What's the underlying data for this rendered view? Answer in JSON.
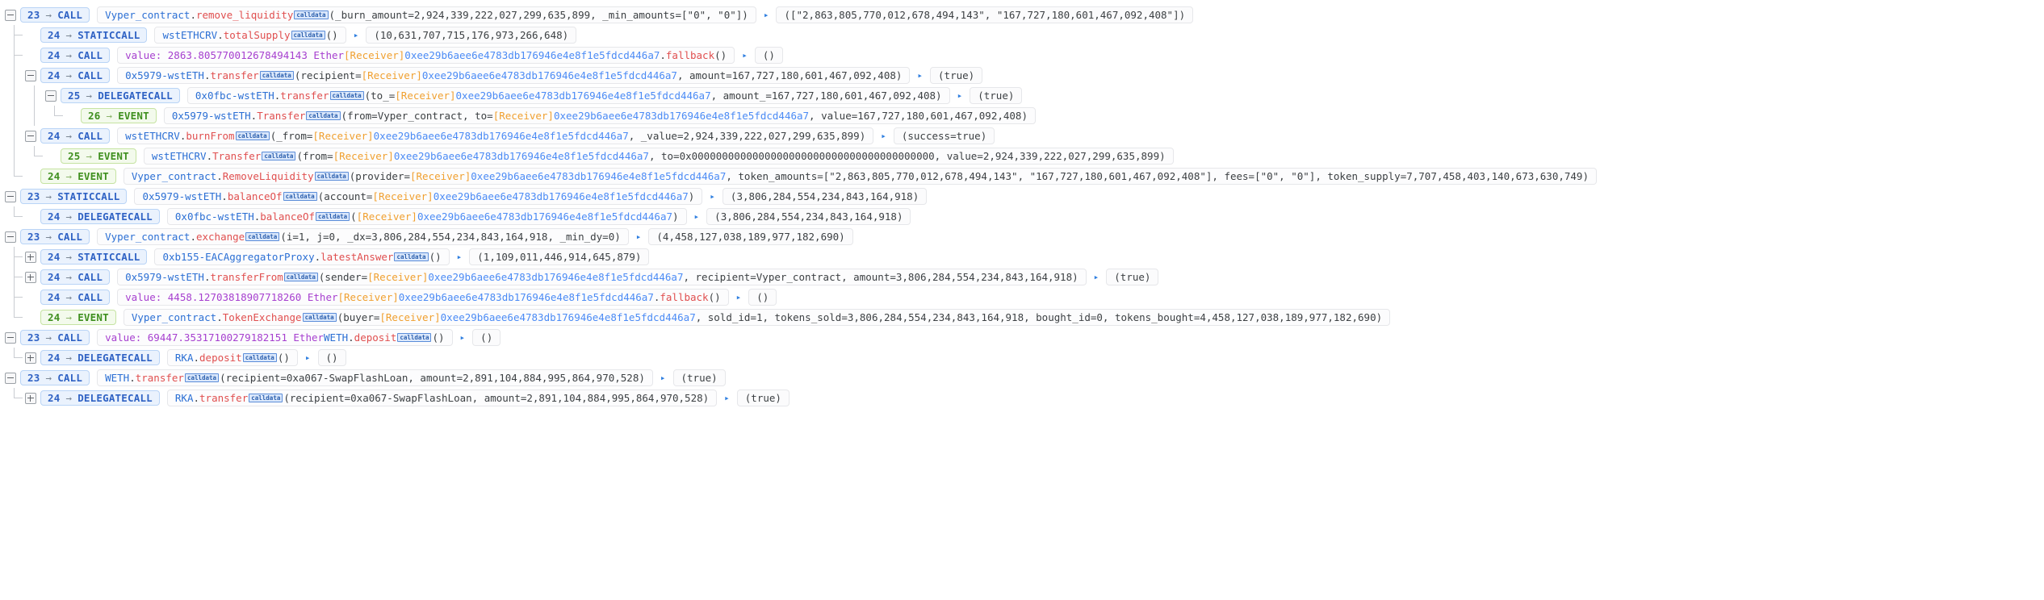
{
  "meta": {
    "view": "transaction-call-trace",
    "accent_call": "#2f62c4",
    "accent_event": "#3f8f1f",
    "accent_method": "#e04f4f",
    "accent_address": "#4b8bf5",
    "accent_tag": "#f0a030",
    "accent_value": "#a63fcf"
  },
  "labels": {
    "arrow": "→",
    "return_arrow": "▸",
    "calldata_badge": "calldata"
  },
  "rows": [
    {
      "indent": 0,
      "connector": "none",
      "expander": "minus",
      "depth": "23",
      "kind": "CALL",
      "call": "Vyper_contract.remove_liquidity(_burn_amount=2,924,339,222,027,299,635,899, _min_amounts=[\"0\", \"0\"])",
      "contract": "Vyper_contract",
      "method": "remove_liquidity",
      "args": "(_burn_amount=2,924,339,222,027,299,635,899, _min_amounts=[\"0\", \"0\"])",
      "has_return": true,
      "result": "([\"2,863,805,770,012,678,494,143\", \"167,727,180,601,467,092,408\"])"
    },
    {
      "indent": 1,
      "connector": "tee",
      "expander": "none",
      "depth": "24",
      "kind": "STATICCALL",
      "contract": "wstETHCRV",
      "method": "totalSupply",
      "args": "()",
      "has_return": true,
      "result": "(10,631,707,715,176,973,266,648)"
    },
    {
      "indent": 1,
      "connector": "tee",
      "expander": "none",
      "depth": "24",
      "kind": "CALL",
      "value_prefix": "value: 2863.805770012678494143 Ether",
      "tag": "[Receiver]",
      "address": "0xee29b6aee6e4783db176946e4e8f1e5fdcd446a7",
      "method": "fallback",
      "args": "()",
      "has_return": true,
      "result": "()"
    },
    {
      "indent": 1,
      "connector": "vline",
      "expander": "minus",
      "depth": "24",
      "kind": "CALL",
      "contract": "0x5979-wstETH",
      "method": "transfer",
      "args_pre": "(recipient=",
      "tag": "[Receiver]",
      "address": "0xee29b6aee6e4783db176946e4e8f1e5fdcd446a7",
      "args_post": ", amount=167,727,180,601,467,092,408)",
      "has_return": true,
      "result": "(true)"
    },
    {
      "indent": 2,
      "connector": "vline",
      "expander": "minus",
      "depth": "25",
      "kind": "DELEGATECALL",
      "contract": "0x0fbc-wstETH",
      "method": "transfer",
      "args_pre": "(to_=",
      "tag": "[Receiver]",
      "address": "0xee29b6aee6e4783db176946e4e8f1e5fdcd446a7",
      "args_post": ", amount_=167,727,180,601,467,092,408)",
      "has_return": true,
      "result": "(true)"
    },
    {
      "indent": 3,
      "connector": "elbow",
      "expander": "none",
      "depth": "26",
      "kind": "EVENT",
      "contract": "0x5979-wstETH",
      "method": "Transfer",
      "args_pre": "(from=Vyper_contract, to=",
      "tag": "[Receiver]",
      "address": "0xee29b6aee6e4783db176946e4e8f1e5fdcd446a7",
      "args_post": ", value=167,727,180,601,467,092,408)",
      "has_return": false,
      "result": ""
    },
    {
      "indent": 1,
      "connector": "vline",
      "expander": "minus",
      "depth": "24",
      "kind": "CALL",
      "contract": "wstETHCRV",
      "method": "burnFrom",
      "args_pre": "(_from=",
      "tag": "[Receiver]",
      "address": "0xee29b6aee6e4783db176946e4e8f1e5fdcd446a7",
      "args_post": ", _value=2,924,339,222,027,299,635,899)",
      "has_return": true,
      "result": "(success=true)"
    },
    {
      "indent": 2,
      "connector": "elbow",
      "expander": "none",
      "depth": "25",
      "kind": "EVENT",
      "contract": "wstETHCRV",
      "method": "Transfer",
      "args_pre": "(from=",
      "tag": "[Receiver]",
      "address": "0xee29b6aee6e4783db176946e4e8f1e5fdcd446a7",
      "args_post": ", to=0x0000000000000000000000000000000000000000, value=2,924,339,222,027,299,635,899)",
      "has_return": false,
      "result": ""
    },
    {
      "indent": 1,
      "connector": "elbow",
      "expander": "none",
      "depth": "24",
      "kind": "EVENT",
      "contract": "Vyper_contract",
      "method": "RemoveLiquidity",
      "args_pre": "(provider=",
      "tag": "[Receiver]",
      "address": "0xee29b6aee6e4783db176946e4e8f1e5fdcd446a7",
      "args_post": ", token_amounts=[\"2,863,805,770,012,678,494,143\", \"167,727,180,601,467,092,408\"], fees=[\"0\", \"0\"], token_supply=7,707,458,403,140,673,630,749)",
      "has_return": false,
      "result": ""
    },
    {
      "indent": 0,
      "connector": "none",
      "expander": "minus",
      "depth": "23",
      "kind": "STATICCALL",
      "contract": "0x5979-wstETH",
      "method": "balanceOf",
      "args_pre": "(account=",
      "tag": "[Receiver]",
      "address": "0xee29b6aee6e4783db176946e4e8f1e5fdcd446a7",
      "args_post": ")",
      "has_return": true,
      "result": "(3,806,284,554,234,843,164,918)"
    },
    {
      "indent": 1,
      "connector": "elbow",
      "expander": "none",
      "depth": "24",
      "kind": "DELEGATECALL",
      "contract": "0x0fbc-wstETH",
      "method": "balanceOf",
      "args_pre": "(",
      "tag": "[Receiver]",
      "address": "0xee29b6aee6e4783db176946e4e8f1e5fdcd446a7",
      "args_post": ")",
      "has_return": true,
      "result": "(3,806,284,554,234,843,164,918)"
    },
    {
      "indent": 0,
      "connector": "none",
      "expander": "minus",
      "depth": "23",
      "kind": "CALL",
      "contract": "Vyper_contract",
      "method": "exchange",
      "args": "(i=1, j=0, _dx=3,806,284,554,234,843,164,918, _min_dy=0)",
      "has_return": true,
      "result": "(4,458,127,038,189,977,182,690)"
    },
    {
      "indent": 1,
      "connector": "tee",
      "expander": "plus",
      "depth": "24",
      "kind": "STATICCALL",
      "contract": "0xb155-EACAggregatorProxy",
      "method": "latestAnswer",
      "args": "()",
      "has_return": true,
      "result": "(1,109,011,446,914,645,879)"
    },
    {
      "indent": 1,
      "connector": "tee",
      "expander": "plus",
      "depth": "24",
      "kind": "CALL",
      "contract": "0x5979-wstETH",
      "method": "transferFrom",
      "args_pre": "(sender=",
      "tag": "[Receiver]",
      "address": "0xee29b6aee6e4783db176946e4e8f1e5fdcd446a7",
      "args_post": ", recipient=Vyper_contract, amount=3,806,284,554,234,843,164,918)",
      "has_return": true,
      "result": "(true)"
    },
    {
      "indent": 1,
      "connector": "tee",
      "expander": "none",
      "depth": "24",
      "kind": "CALL",
      "value_prefix": "value: 4458.12703818907718260 Ether",
      "tag": "[Receiver]",
      "address": "0xee29b6aee6e4783db176946e4e8f1e5fdcd446a7",
      "method": "fallback",
      "args": "()",
      "has_return": true,
      "result": "()"
    },
    {
      "indent": 1,
      "connector": "elbow",
      "expander": "none",
      "depth": "24",
      "kind": "EVENT",
      "contract": "Vyper_contract",
      "method": "TokenExchange",
      "args_pre": "(buyer=",
      "tag": "[Receiver]",
      "address": "0xee29b6aee6e4783db176946e4e8f1e5fdcd446a7",
      "args_post": ", sold_id=1, tokens_sold=3,806,284,554,234,843,164,918, bought_id=0, tokens_bought=4,458,127,038,189,977,182,690)",
      "has_return": false,
      "result": ""
    },
    {
      "indent": 0,
      "connector": "none",
      "expander": "minus",
      "depth": "23",
      "kind": "CALL",
      "value_prefix": "value: 69447.35317100279182151 Ether",
      "contract": "WETH",
      "method": "deposit",
      "args": "()",
      "has_return": true,
      "result": "()"
    },
    {
      "indent": 1,
      "connector": "elbow",
      "expander": "plus",
      "depth": "24",
      "kind": "DELEGATECALL",
      "contract": "RKA",
      "method": "deposit",
      "args": "()",
      "has_return": true,
      "result": "()"
    },
    {
      "indent": 0,
      "connector": "none",
      "expander": "minus",
      "depth": "23",
      "kind": "CALL",
      "contract": "WETH",
      "method": "transfer",
      "args": "(recipient=0xa067-SwapFlashLoan, amount=2,891,104,884,995,864,970,528)",
      "has_return": true,
      "result": "(true)"
    },
    {
      "indent": 1,
      "connector": "elbow",
      "expander": "plus",
      "depth": "24",
      "kind": "DELEGATECALL",
      "contract": "RKA",
      "method": "transfer",
      "args": "(recipient=0xa067-SwapFlashLoan, amount=2,891,104,884,995,864,970,528)",
      "has_return": true,
      "result": "(true)"
    }
  ]
}
